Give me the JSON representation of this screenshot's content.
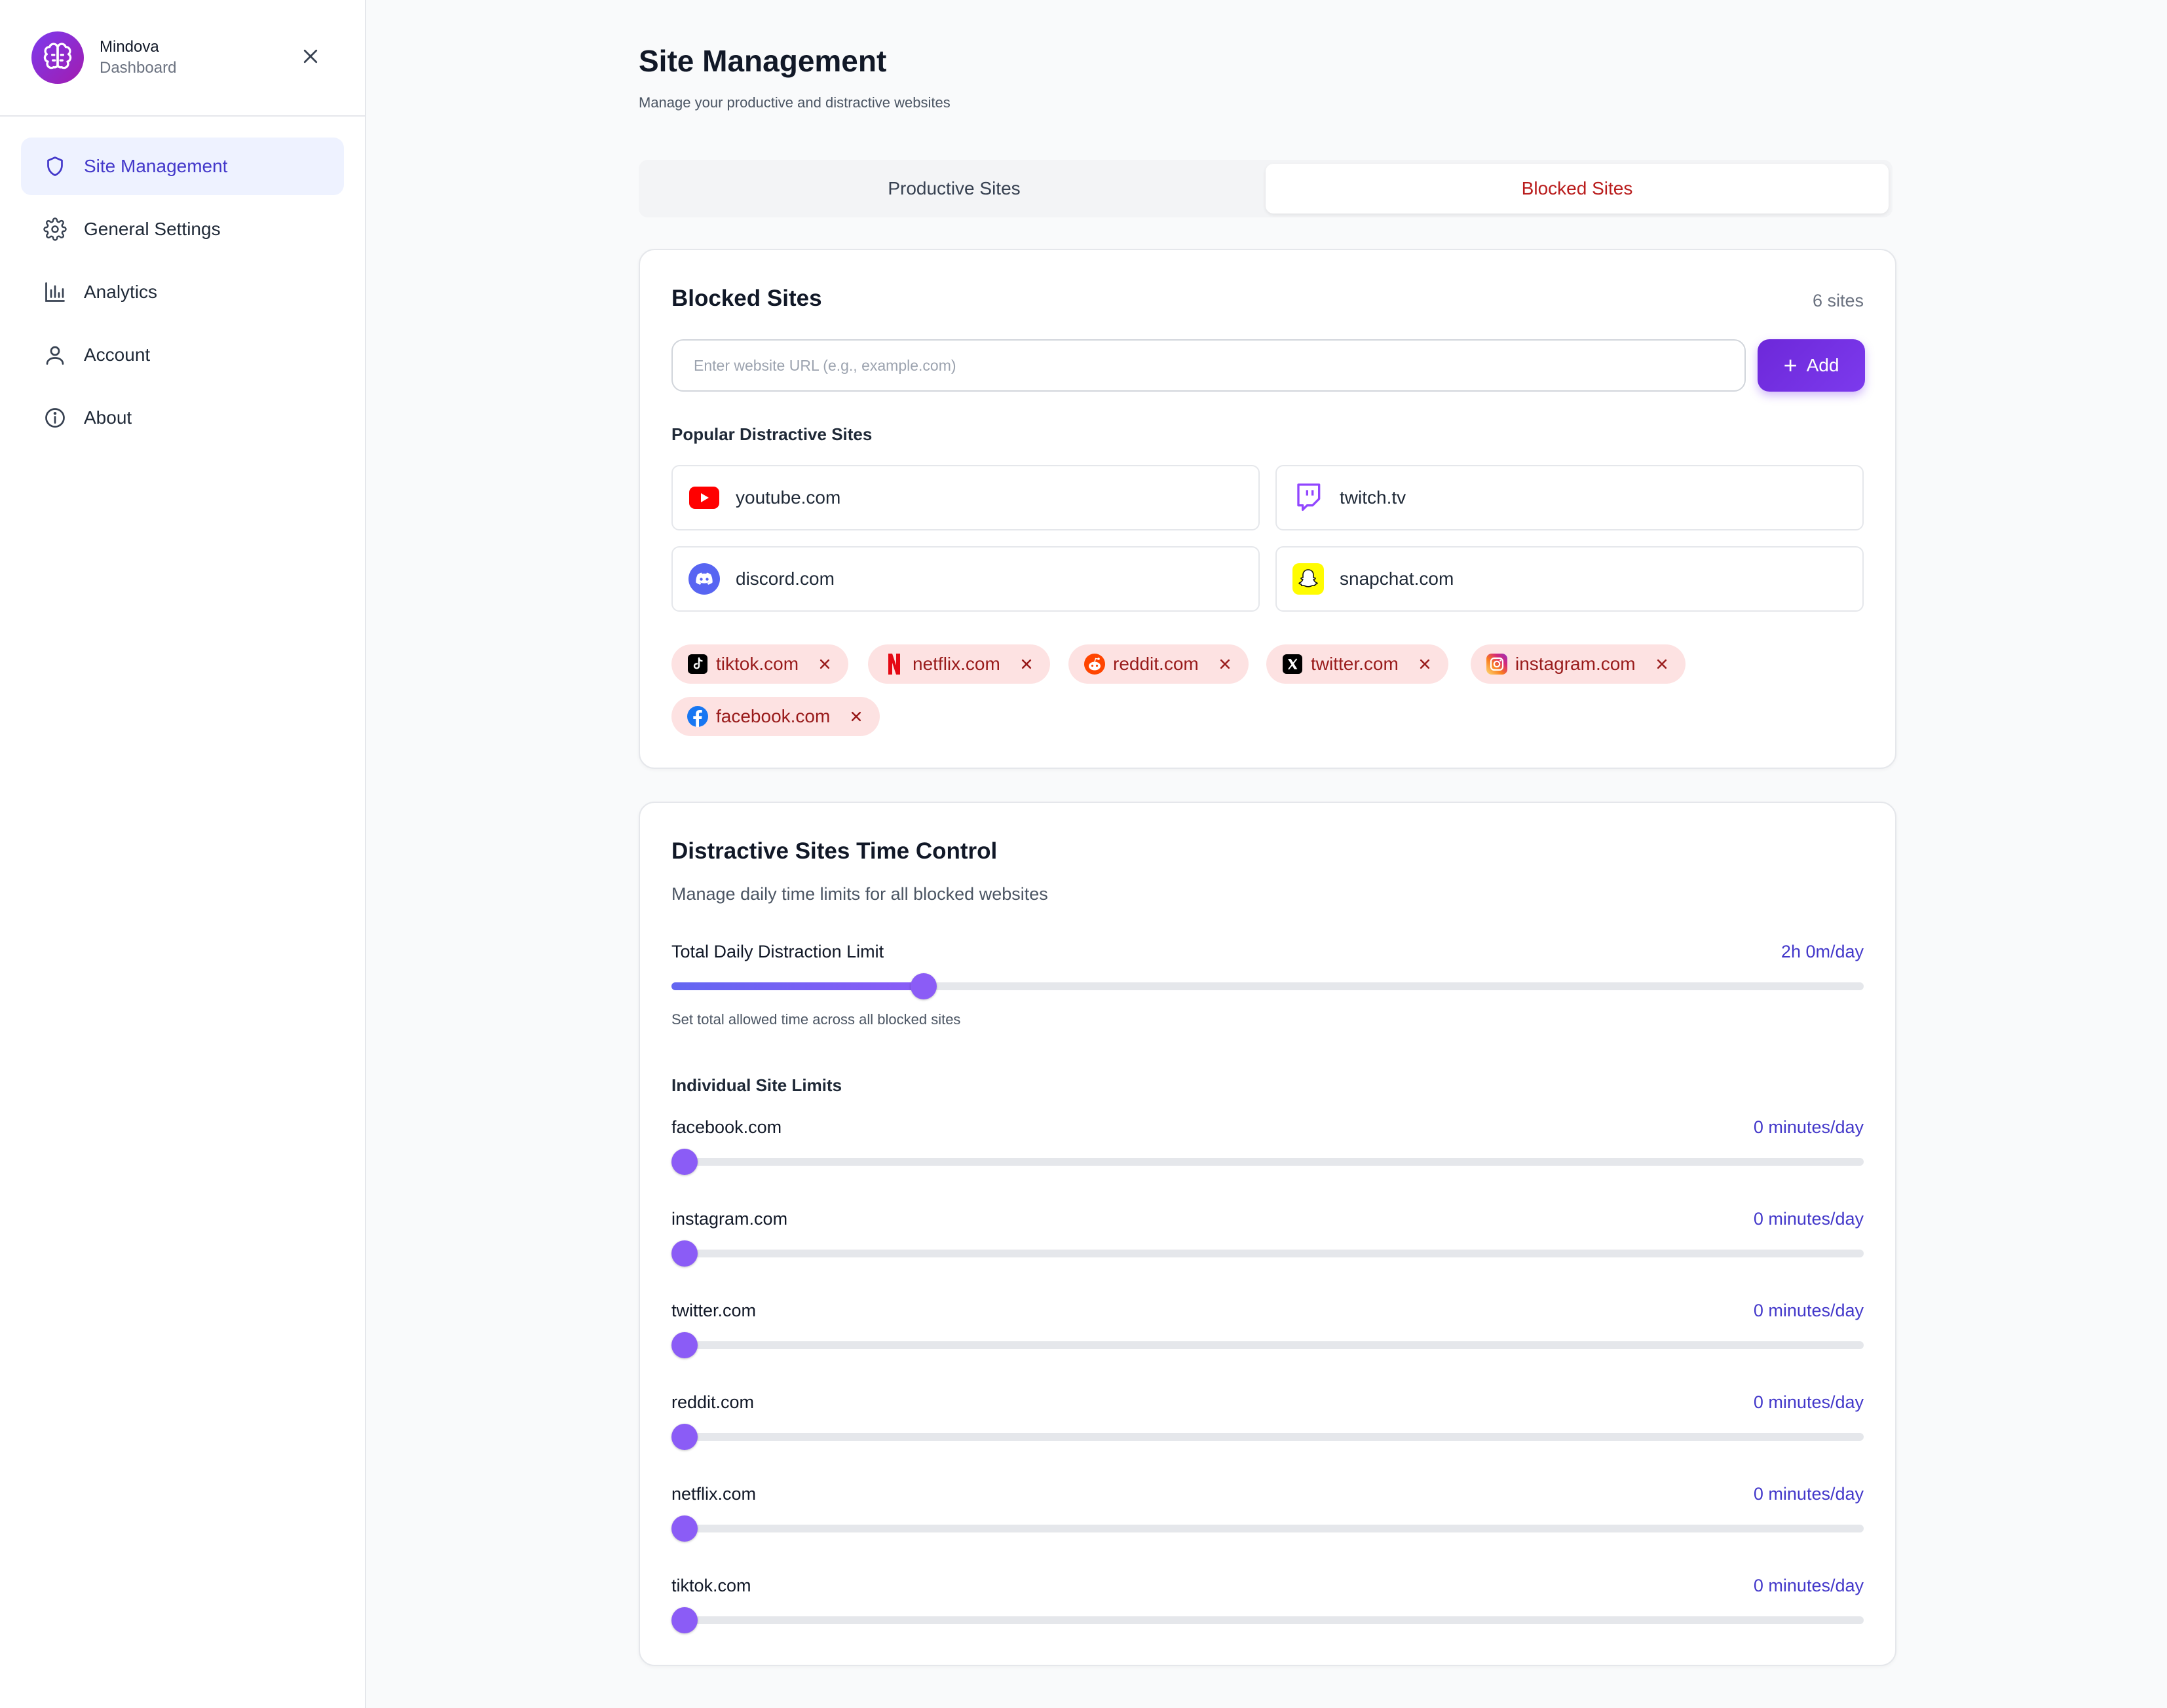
{
  "brand": {
    "name": "Mindova",
    "subtitle": "Dashboard"
  },
  "sidebar": {
    "items": [
      {
        "label": "Site Management",
        "icon": "shield-icon",
        "active": true
      },
      {
        "label": "General Settings",
        "icon": "gear-icon"
      },
      {
        "label": "Analytics",
        "icon": "bar-chart-icon"
      },
      {
        "label": "Account",
        "icon": "user-icon"
      },
      {
        "label": "About",
        "icon": "info-icon"
      }
    ]
  },
  "page": {
    "title": "Site Management",
    "subtitle": "Manage your productive and distractive websites"
  },
  "tabs": [
    {
      "label": "Productive Sites",
      "active": false
    },
    {
      "label": "Blocked Sites",
      "active": true
    }
  ],
  "blocked": {
    "title": "Blocked Sites",
    "count_label": "6 sites",
    "input_placeholder": "Enter website URL (e.g., example.com)",
    "input_value": "",
    "add_label": "Add",
    "popular_title": "Popular Distractive Sites",
    "popular": [
      {
        "label": "youtube.com",
        "icon": "youtube-icon",
        "color": "#ff0000"
      },
      {
        "label": "twitch.tv",
        "icon": "twitch-icon",
        "color": "#9146ff"
      },
      {
        "label": "discord.com",
        "icon": "discord-icon",
        "color": "#5865f2"
      },
      {
        "label": "snapchat.com",
        "icon": "snapchat-icon",
        "color": "#fffc00"
      }
    ],
    "chips": [
      {
        "label": "tiktok.com",
        "icon": "tiktok-icon"
      },
      {
        "label": "netflix.com",
        "icon": "netflix-icon"
      },
      {
        "label": "reddit.com",
        "icon": "reddit-icon"
      },
      {
        "label": "twitter.com",
        "icon": "x-icon"
      },
      {
        "label": "instagram.com",
        "icon": "instagram-icon"
      },
      {
        "label": "facebook.com",
        "icon": "facebook-icon"
      }
    ]
  },
  "time_control": {
    "title": "Distractive Sites Time Control",
    "description": "Manage daily time limits for all blocked websites",
    "total_label": "Total Daily Distraction Limit",
    "total_value_label": "2h 0m/day",
    "total_fraction": 0.205,
    "hint": "Set total allowed time across all blocked sites",
    "individual_title": "Individual Site Limits",
    "sites": [
      {
        "label": "facebook.com",
        "value_label": "0 minutes/day",
        "fraction": 0
      },
      {
        "label": "instagram.com",
        "value_label": "0 minutes/day",
        "fraction": 0
      },
      {
        "label": "twitter.com",
        "value_label": "0 minutes/day",
        "fraction": 0
      },
      {
        "label": "reddit.com",
        "value_label": "0 minutes/day",
        "fraction": 0
      },
      {
        "label": "netflix.com",
        "value_label": "0 minutes/day",
        "fraction": 0
      },
      {
        "label": "tiktok.com",
        "value_label": "0 minutes/day",
        "fraction": 0
      }
    ]
  },
  "colors": {
    "accent": "#7c3aed",
    "active_nav_bg": "#eef2ff",
    "active_nav_text": "#4338ca",
    "blocked_tab_text": "#b91c1c",
    "chip_bg": "#fde2e2",
    "chip_text": "#991b1b"
  }
}
